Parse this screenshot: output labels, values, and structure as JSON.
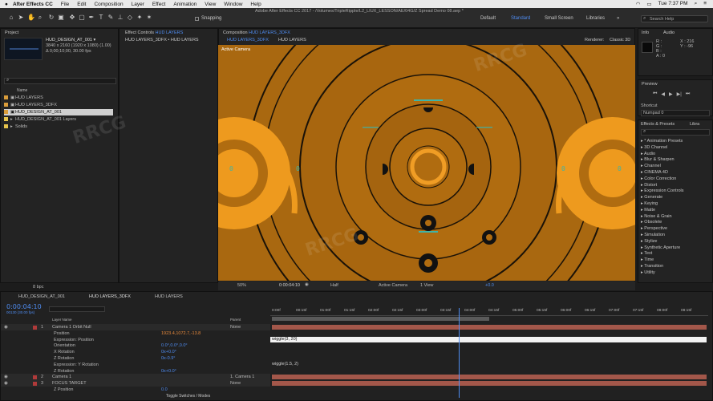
{
  "menubar": {
    "app": "After Effects CC",
    "items": [
      "File",
      "Edit",
      "Composition",
      "Layer",
      "Effect",
      "Animation",
      "View",
      "Window",
      "Help"
    ],
    "time": "Tue 7:37 PM"
  },
  "toolbar": {
    "snapping": "Snapping",
    "path": "Adobe After Effects CC 2017 - /Volumes/TripleRipple/L2_LIUX_LESSON/AE/04G/Z Spread Demo 08.aep *",
    "workspaces": [
      "Default",
      "Standard",
      "Small Screen",
      "Libraries"
    ],
    "active_workspace": "Standard",
    "search_placeholder": "Search Help"
  },
  "project": {
    "tab": "Project",
    "comp_name": "HUD_DESIGN_AT_001 ▾",
    "comp_info1": "3840 x 2160 (1920 x 1080) (1.00)",
    "comp_info2": "Δ 0;00;10;00, 30.00 fps",
    "col_name": "Name",
    "items": [
      "HUD LAYERS",
      "HUD LAYERS_3DFX",
      "HUD_DESIGN_AT_001",
      "HUD_DESIGN_AT_001 Layers",
      "Solids"
    ],
    "bpc": "8 bpc"
  },
  "effect_controls": {
    "tab": "Effect Controls",
    "tab_layer": "HUD LAYERS",
    "breadcrumb": "HUD LAYERS_3DFX • HUD LAYERS"
  },
  "composition": {
    "tab": "Composition",
    "tab_comp": "HUD LAYERS_3DFX",
    "sub1": "HUD LAYERS_3DFX",
    "sub2": "HUD LAYERS",
    "renderer": "Renderer:",
    "renderer_value": "Classic 3D",
    "active_camera": "Active Camera",
    "footer": {
      "zoom": "50%",
      "timecode": "0:00:04:10",
      "resolution": "Half",
      "view": "Active Camera",
      "views": "1 View",
      "offset": "+0.0"
    }
  },
  "info": {
    "tab": "Info",
    "tab2": "Audio",
    "r": "R :",
    "g": "G :",
    "b": "B :",
    "a": "A : 0",
    "x": "X : 216",
    "y": "Y : -96"
  },
  "preview": {
    "tab": "Preview"
  },
  "shortcut": {
    "label": "Shortcut",
    "value": "Numpad 0"
  },
  "effects_presets": {
    "tab": "Effects & Presets",
    "tab2": "Libra",
    "search_placeholder": "",
    "items": [
      "* Animation Presets",
      "3D Channel",
      "Audio",
      "Blur & Sharpen",
      "Channel",
      "CINEMA 4D",
      "Color Correction",
      "Distort",
      "Expression Controls",
      "Generate",
      "Keying",
      "Matte",
      "Noise & Grain",
      "Obsolete",
      "Perspective",
      "Simulation",
      "Stylize",
      "Synthetic Aperture",
      "Text",
      "Time",
      "Transition",
      "Utility"
    ]
  },
  "timeline": {
    "tabs": [
      "HUD_DESIGN_AT_001",
      "HUD LAYERS_3DFX",
      "HUD LAYERS"
    ],
    "active_tab": "HUD LAYERS_3DFX",
    "timecode": "0:00:04:10",
    "timecode_sub": "00130 (30.00 fps)",
    "col_layer": "Layer Name",
    "col_parent": "Parent",
    "ruler": [
      "0:00f",
      "00:15f",
      "01:00f",
      "01:15f",
      "02:00f",
      "02:15f",
      "03:00f",
      "03:15f",
      "04:00f",
      "04:15f",
      "05:00f",
      "05:15f",
      "06:00f",
      "06:15f",
      "07:00f",
      "07:15f",
      "08:00f",
      "08:15f"
    ],
    "rows": [
      {
        "num": "1",
        "name": "Camera 1 Orbit Null",
        "value": "",
        "parent": "None"
      },
      {
        "num": "",
        "name": "Position",
        "value": "1923.4,1072.7,-13.8",
        "parent": ""
      },
      {
        "num": "",
        "name": "Expression: Position",
        "value": "",
        "parent": ""
      },
      {
        "num": "",
        "name": "Orientation",
        "value": "0.0°,0.0°,0.0°",
        "parent": ""
      },
      {
        "num": "",
        "name": "X Rotation",
        "value": "0x+0.0°",
        "parent": ""
      },
      {
        "num": "",
        "name": "Z Rotation",
        "value": "0x-0.9°",
        "parent": ""
      },
      {
        "num": "",
        "name": "Expression: Y Rotation",
        "value": "",
        "parent": ""
      },
      {
        "num": "",
        "name": "Z Rotation",
        "value": "0x+0.0°",
        "parent": ""
      },
      {
        "num": "2",
        "name": "Camera 1",
        "value": "",
        "parent": "1. Camera 1"
      },
      {
        "num": "3",
        "name": "FOCUS TARGET",
        "value": "",
        "parent": "None"
      },
      {
        "num": "",
        "name": "Z Position",
        "value": "0.0",
        "parent": ""
      }
    ],
    "expression1": "wiggle(3, 20)",
    "expression2": "wiggle(1.5, 2)",
    "toggle": "Toggle Switches / Modes"
  },
  "viewer_readouts": [
    "0",
    "0",
    "0",
    "0"
  ],
  "colors": {
    "accent": "#4f8cf0",
    "hud_orange": "#b06c10",
    "layer_bar": "#a3574a"
  }
}
